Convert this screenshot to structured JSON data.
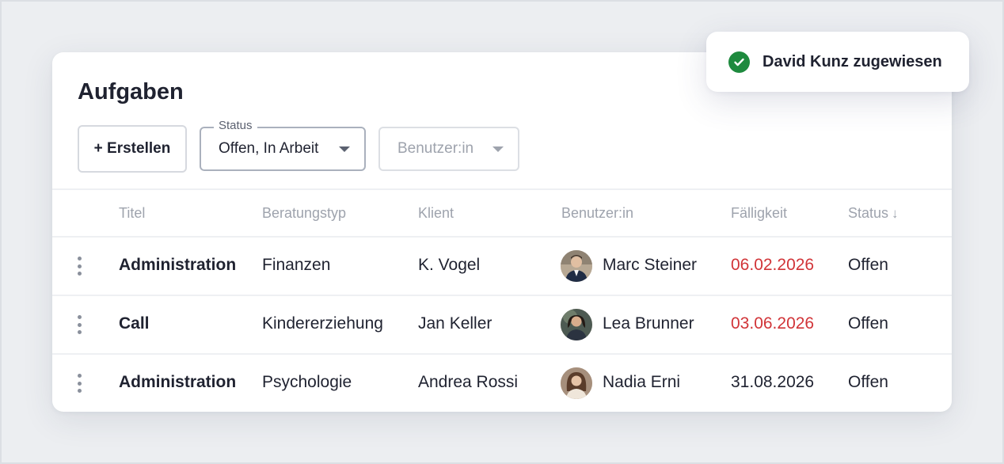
{
  "page": {
    "title": "Aufgaben"
  },
  "toolbar": {
    "create_label": "+ Erstellen",
    "status_filter": {
      "legend": "Status",
      "value": "Offen, In Arbeit"
    },
    "user_filter": {
      "placeholder": "Benutzer:in"
    }
  },
  "table": {
    "headers": {
      "title": "Titel",
      "type": "Beratungstyp",
      "client": "Klient",
      "user": "Benutzer:in",
      "due": "Fälligkeit",
      "status": "Status"
    },
    "rows": [
      {
        "title": "Administration",
        "type": "Finanzen",
        "client": "K. Vogel",
        "user": "Marc Steiner",
        "due": "06.02.2026",
        "due_overdue": true,
        "status": "Offen"
      },
      {
        "title": "Call",
        "type": "Kindererziehung",
        "client": "Jan Keller",
        "user": "Lea Brunner",
        "due": "03.06.2026",
        "due_overdue": true,
        "status": "Offen"
      },
      {
        "title": "Administration",
        "type": "Psychologie",
        "client": "Andrea Rossi",
        "user": "Nadia Erni",
        "due": "31.08.2026",
        "due_overdue": false,
        "status": "Offen"
      }
    ]
  },
  "toast": {
    "message": "David Kunz zugewiesen",
    "icon": "check-circle-icon"
  },
  "colors": {
    "overdue": "#d13438",
    "success": "#1e8a3e",
    "text": "#1f2230",
    "muted": "#9ea3ad"
  }
}
